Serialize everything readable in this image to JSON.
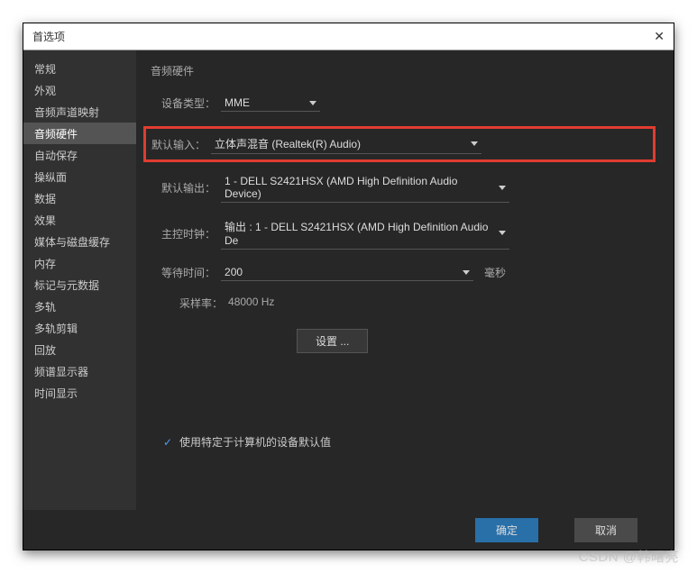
{
  "dialog": {
    "title": "首选项"
  },
  "sidebar": {
    "items": [
      {
        "label": "常规"
      },
      {
        "label": "外观"
      },
      {
        "label": "音频声道映射"
      },
      {
        "label": "音频硬件"
      },
      {
        "label": "自动保存"
      },
      {
        "label": "操纵面"
      },
      {
        "label": "数据"
      },
      {
        "label": "效果"
      },
      {
        "label": "媒体与磁盘缓存"
      },
      {
        "label": "内存"
      },
      {
        "label": "标记与元数据"
      },
      {
        "label": "多轨"
      },
      {
        "label": "多轨剪辑"
      },
      {
        "label": "回放"
      },
      {
        "label": "频谱显示器"
      },
      {
        "label": "时间显示"
      }
    ],
    "activeIndex": 3
  },
  "content": {
    "sectionTitle": "音频硬件",
    "deviceType": {
      "label": "设备类型：",
      "value": "MME"
    },
    "defaultInput": {
      "label": "默认输入：",
      "value": "立体声混音 (Realtek(R) Audio)"
    },
    "defaultOutput": {
      "label": "默认输出：",
      "value": "1 - DELL S2421HSX (AMD High Definition Audio Device)"
    },
    "masterClock": {
      "label": "主控时钟：",
      "value": "输出 : 1 - DELL S2421HSX (AMD High Definition Audio De"
    },
    "latency": {
      "label": "等待时间：",
      "value": "200",
      "unit": "毫秒"
    },
    "sampleRate": {
      "label": "采样率：",
      "value": "48000 Hz"
    },
    "settingsButton": "设置 ...",
    "useDefaultCheckbox": "使用特定于计算机的设备默认值"
  },
  "footer": {
    "ok": "确定",
    "cancel": "取消"
  },
  "watermark": "CSDN @韩曙亮"
}
